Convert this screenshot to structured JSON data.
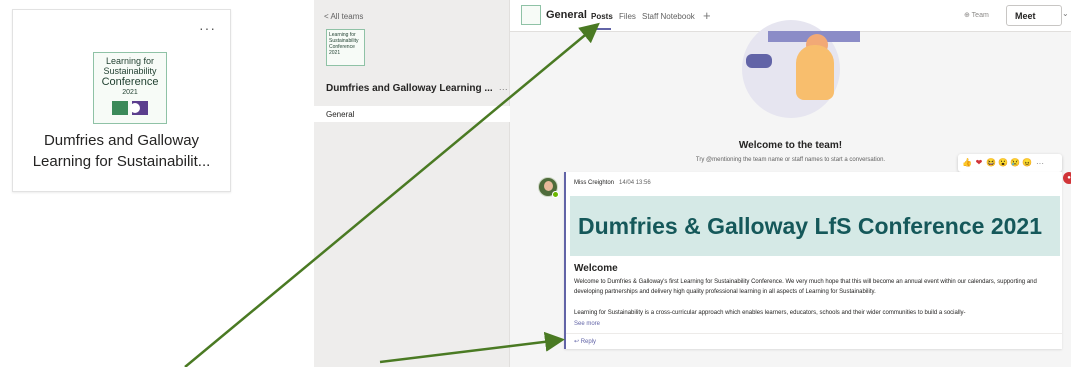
{
  "team_card": {
    "more": "···",
    "logo_lines": [
      "Learning for",
      "Sustainability",
      "Conference",
      "2021"
    ],
    "title": "Dumfries and Galloway Learning for Sustainabilit..."
  },
  "sidebar": {
    "back": "< All teams",
    "logo_text": "Learning for Sustainability Conference 2021",
    "team_name": "Dumfries and Galloway Learning ...",
    "team_more": "···",
    "channels": [
      {
        "label": "General"
      }
    ]
  },
  "header": {
    "channel": "General",
    "tabs": [
      {
        "label": "Posts"
      },
      {
        "label": "Files"
      },
      {
        "label": "Staff Notebook"
      }
    ],
    "add_tab": "+",
    "team_label": "⊕ Team",
    "meet_label": "Meet",
    "meet_chevron": "⌄"
  },
  "feed": {
    "welcome_title": "Welcome to the team!",
    "welcome_sub": "Try @mentioning the team name or staff names to start a conversation.",
    "reactions": [
      "👍",
      "❤",
      "😆",
      "😮",
      "😢",
      "😠"
    ],
    "reactions_more": "···",
    "message": {
      "author": "Miss Creighton",
      "time": "14/04 13:56",
      "banner": "Dumfries & Galloway LfS Conference 2021",
      "heading": "Welcome",
      "p1": "Welcome to Dumfries & Galloway's first Learning for Sustainability Conference.  We very much hope that this will become an annual event within our calendars, supporting and developing partnerships and delivery high quality professional learning in all aspects of Learning for Sustainability.",
      "p2": "Learning for Sustainability is a cross-curricular approach which enables learners, educators, schools and their wider communities to build a socially-",
      "see_more": "See more",
      "reply": "↩ Reply"
    }
  },
  "colors": {
    "accent": "#6264a7",
    "banner_bg": "#d5e9e6",
    "banner_text": "#15585a",
    "arrow": "#4a7a23"
  }
}
